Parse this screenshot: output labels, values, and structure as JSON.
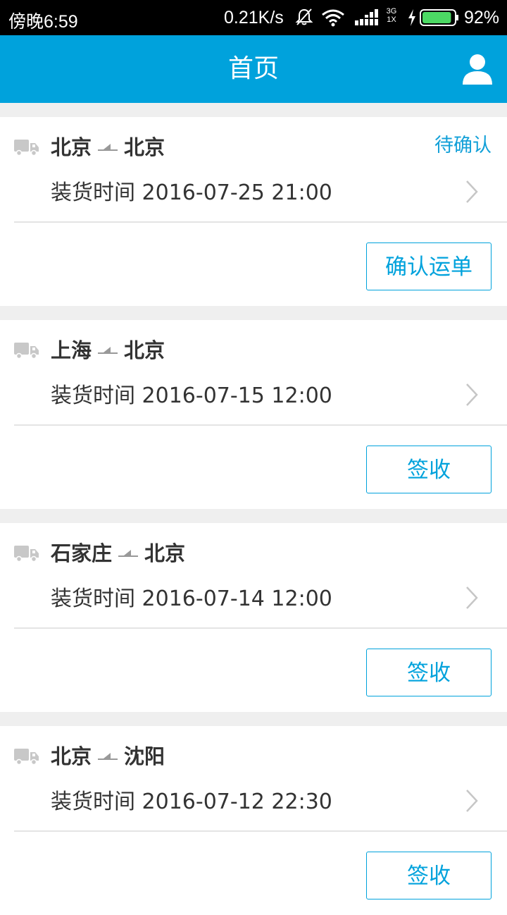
{
  "status_bar": {
    "time": "傍晚6:59",
    "speed": "0.21K/s",
    "network_top": "3G",
    "network_bottom": "1X",
    "battery_pct": "92%",
    "battery_level": 0.92
  },
  "header": {
    "title": "首页",
    "user_icon": "user-icon"
  },
  "orders": [
    {
      "from": "北京",
      "to": "北京",
      "status": "待确认",
      "load_label": "装货时间",
      "load_time": "2016-07-25 21:00",
      "action": "确认运单"
    },
    {
      "from": "上海",
      "to": "北京",
      "status": "",
      "load_label": "装货时间",
      "load_time": "2016-07-15 12:00",
      "action": "签收"
    },
    {
      "from": "石家庄",
      "to": "北京",
      "status": "",
      "load_label": "装货时间",
      "load_time": "2016-07-14 12:00",
      "action": "签收"
    },
    {
      "from": "北京",
      "to": "沈阳",
      "status": "",
      "load_label": "装货时间",
      "load_time": "2016-07-12 22:30",
      "action": "签收"
    }
  ],
  "colors": {
    "primary": "#00a2dc",
    "text": "#333333",
    "background": "#efefef"
  }
}
